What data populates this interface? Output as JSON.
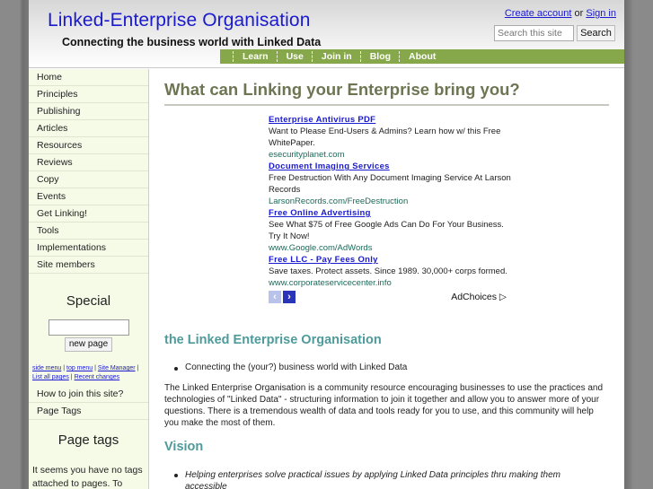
{
  "header": {
    "site_title": "Linked-Enterprise Organisation",
    "subtitle": "Connecting the business world with Linked Data",
    "create_account": "Create account",
    "or": "or",
    "sign_in": "Sign in",
    "search_placeholder": "Search this site",
    "search_button": "Search"
  },
  "topnav": {
    "items": [
      "Learn",
      "Use",
      "Join in",
      "Blog",
      "About"
    ]
  },
  "sidebar": {
    "items": [
      "Home",
      "Principles",
      "Publishing",
      "Articles",
      "Resources",
      "Reviews",
      "Copy",
      "Events",
      "Get Linking!",
      "Tools",
      "Implementations",
      "Site members"
    ],
    "special_title": "Special",
    "new_page_button": "new page",
    "links": {
      "side_menu": "side menu",
      "top_menu": "top menu",
      "site_manager": "Site Manager",
      "list_all_pages": "List all pages",
      "recent_changes": "Recent changes",
      "separator": " | "
    },
    "items2": [
      "How to join this site?",
      "Page Tags"
    ],
    "page_tags_title": "Page tags",
    "page_tags_text": "It seems you have no tags attached to pages. To"
  },
  "main": {
    "page_title": "What can Linking your Enterprise bring you?",
    "ads": [
      {
        "title": "Enterprise Antivirus PDF",
        "desc": "Want to Please End-Users & Admins? Learn how w/ this Free WhitePaper.",
        "url": "esecurityplanet.com"
      },
      {
        "title": "Document Imaging Services",
        "desc": "Free Destruction With Any Document Imaging Service At Larson Records",
        "url": "LarsonRecords.com/FreeDestruction"
      },
      {
        "title": "Free Online Advertising",
        "desc": "See What $75 of Free Google Ads Can Do For Your Business. Try It Now!",
        "url": "www.Google.com/AdWords"
      },
      {
        "title": "Free LLC - Pay Fees Only",
        "desc": "Save taxes. Protect assets. Since 1989. 30,000+ corps formed.",
        "url": "www.corporateservicecenter.info"
      }
    ],
    "ad_prev": "‹",
    "ad_next": "›",
    "adchoices": "AdChoices ▷",
    "section1_title": "the Linked Enterprise Organisation",
    "section1_bullet": "Connecting the (your?) business world with Linked Data",
    "section1_para": "The Linked Enterprise Organisation is a community resource encouraging businesses to use the practices and technologies of \"Linked Data\" - structuring information to join it together and allow you to answer more of your questions. There is a tremendous wealth of data and tools ready for you to use, and this community will help you make the most of them.",
    "vision_title": "Vision",
    "vision_bullet": "Helping enterprises solve practical issues by applying Linked Data principles thru making them accessible"
  }
}
